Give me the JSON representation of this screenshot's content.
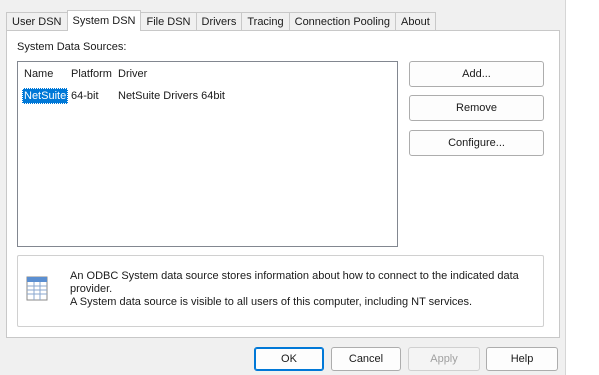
{
  "tabs": [
    "User DSN",
    "System DSN",
    "File DSN",
    "Drivers",
    "Tracing",
    "Connection Pooling",
    "About"
  ],
  "active_tab": "System DSN",
  "section_label": "System Data Sources:",
  "columns": {
    "name": "Name",
    "platform": "Platform",
    "driver": "Driver"
  },
  "rows": [
    {
      "name": "NetSuite",
      "platform": "64-bit",
      "driver": "NetSuite Drivers 64bit"
    }
  ],
  "side_buttons": {
    "add": "Add...",
    "remove": "Remove",
    "configure": "Configure..."
  },
  "info": {
    "line1": "An ODBC System data source stores information about how to connect to the indicated data provider.",
    "line2": "A System data source is visible to all users of this computer, including NT services."
  },
  "footer_buttons": {
    "ok": "OK",
    "cancel": "Cancel",
    "apply": "Apply",
    "help": "Help"
  },
  "colors": {
    "selection": "#0078d7",
    "accent": "#0078d7"
  }
}
